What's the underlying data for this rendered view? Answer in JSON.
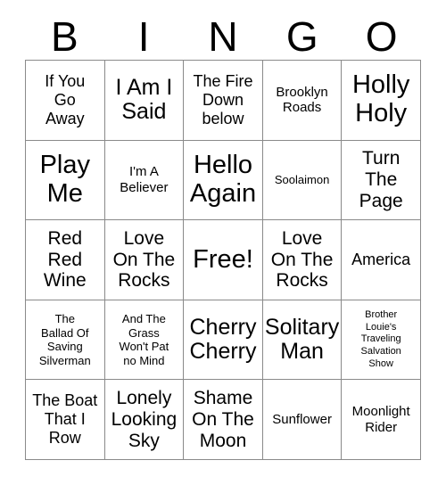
{
  "card": {
    "header_letters": [
      "B",
      "I",
      "N",
      "G",
      "O"
    ],
    "free_space_label": "Free!",
    "colors": {
      "text": "#000000",
      "border": "#8a8a8a",
      "background": "#ffffff"
    },
    "rows": [
      [
        {
          "text": "If You\nGo\nAway",
          "size": "md"
        },
        {
          "text": "I Am I\nSaid",
          "size": "xl"
        },
        {
          "text": "The Fire\nDown\nbelow",
          "size": "md"
        },
        {
          "text": "Brooklyn\nRoads",
          "size": "sm"
        },
        {
          "text": "Holly\nHoly",
          "size": "xxl"
        }
      ],
      [
        {
          "text": "Play\nMe",
          "size": "xxl"
        },
        {
          "text": "I'm A\nBeliever",
          "size": "sm"
        },
        {
          "text": "Hello\nAgain",
          "size": "xxl"
        },
        {
          "text": "Soolaimon",
          "size": "xs"
        },
        {
          "text": "Turn\nThe\nPage",
          "size": "lg"
        }
      ],
      [
        {
          "text": "Red\nRed\nWine",
          "size": "lg"
        },
        {
          "text": "Love\nOn The\nRocks",
          "size": "lg"
        },
        {
          "text": "Free!",
          "size": "xxl"
        },
        {
          "text": "Love\nOn The\nRocks",
          "size": "lg"
        },
        {
          "text": "America",
          "size": "md"
        }
      ],
      [
        {
          "text": "The\nBallad Of\nSaving\nSilverman",
          "size": "xs"
        },
        {
          "text": "And The\nGrass\nWon't Pat\nno Mind",
          "size": "xs"
        },
        {
          "text": "Cherry\nCherry",
          "size": "xl"
        },
        {
          "text": "Solitary\nMan",
          "size": "xl"
        },
        {
          "text": "Brother\nLouie's\nTraveling\nSalvation\nShow",
          "size": "xxs"
        }
      ],
      [
        {
          "text": "The Boat\nThat I\nRow",
          "size": "md"
        },
        {
          "text": "Lonely\nLooking\nSky",
          "size": "lg"
        },
        {
          "text": "Shame\nOn The\nMoon",
          "size": "lg"
        },
        {
          "text": "Sunflower",
          "size": "sm"
        },
        {
          "text": "Moonlight\nRider",
          "size": "sm"
        }
      ]
    ]
  }
}
